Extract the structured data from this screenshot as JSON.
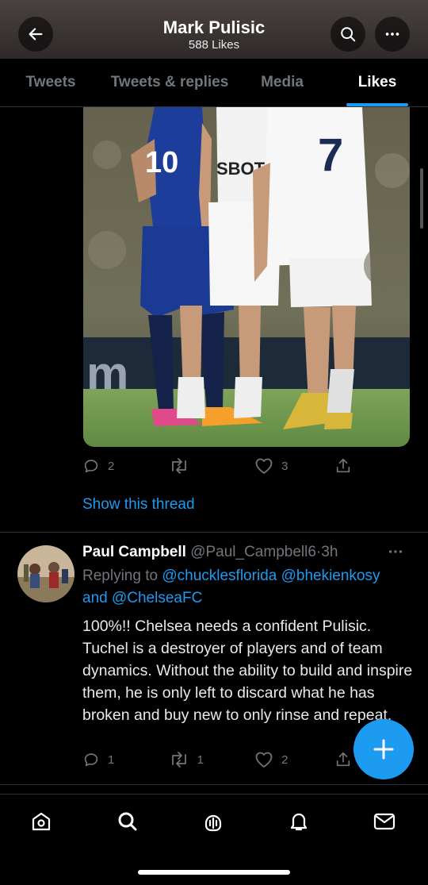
{
  "header": {
    "title": "Mark Pulisic",
    "subtitle": "588 Likes",
    "back_icon": "arrow-left-icon",
    "search_icon": "search-icon",
    "more_icon": "more-horizontal-icon"
  },
  "tabs": [
    {
      "label": "Tweets"
    },
    {
      "label": "Tweets & replies"
    },
    {
      "label": "Media"
    },
    {
      "label": "Likes",
      "active": true
    }
  ],
  "tweet1": {
    "image_description": "",
    "image_text_left": "10",
    "image_text_right": "7",
    "image_sponsor": "SBOT",
    "reply_count": "2",
    "retweet_count": "",
    "like_count": "3",
    "show_thread": "Show this thread"
  },
  "tweet2": {
    "name": "Paul Campbell",
    "handle": "@Paul_Campbell6",
    "separator": "·",
    "time": "3h",
    "replying_to": "Replying to",
    "mention1": "@chucklesflorida",
    "mention2": "@bhekienkosy",
    "and": "and",
    "mention3": "@ChelseaFC",
    "text": "100%!! Chelsea needs a confident Pulisic. Tuchel is a destroyer of players and of team dynamics. Without the ability to build and inspire them, he is only left to discard what he has broken and buy new to only rinse and repeat.",
    "reply_count": "1",
    "retweet_count": "1",
    "like_count": "2"
  },
  "fab": {
    "icon": "compose-plus-icon"
  },
  "bottom_nav": [
    {
      "icon": "home-icon"
    },
    {
      "icon": "search-icon"
    },
    {
      "icon": "spaces-icon"
    },
    {
      "icon": "notifications-icon"
    },
    {
      "icon": "messages-icon"
    }
  ],
  "colors": {
    "accent": "#1d9bf0",
    "muted": "#71767b",
    "background": "#000000"
  }
}
